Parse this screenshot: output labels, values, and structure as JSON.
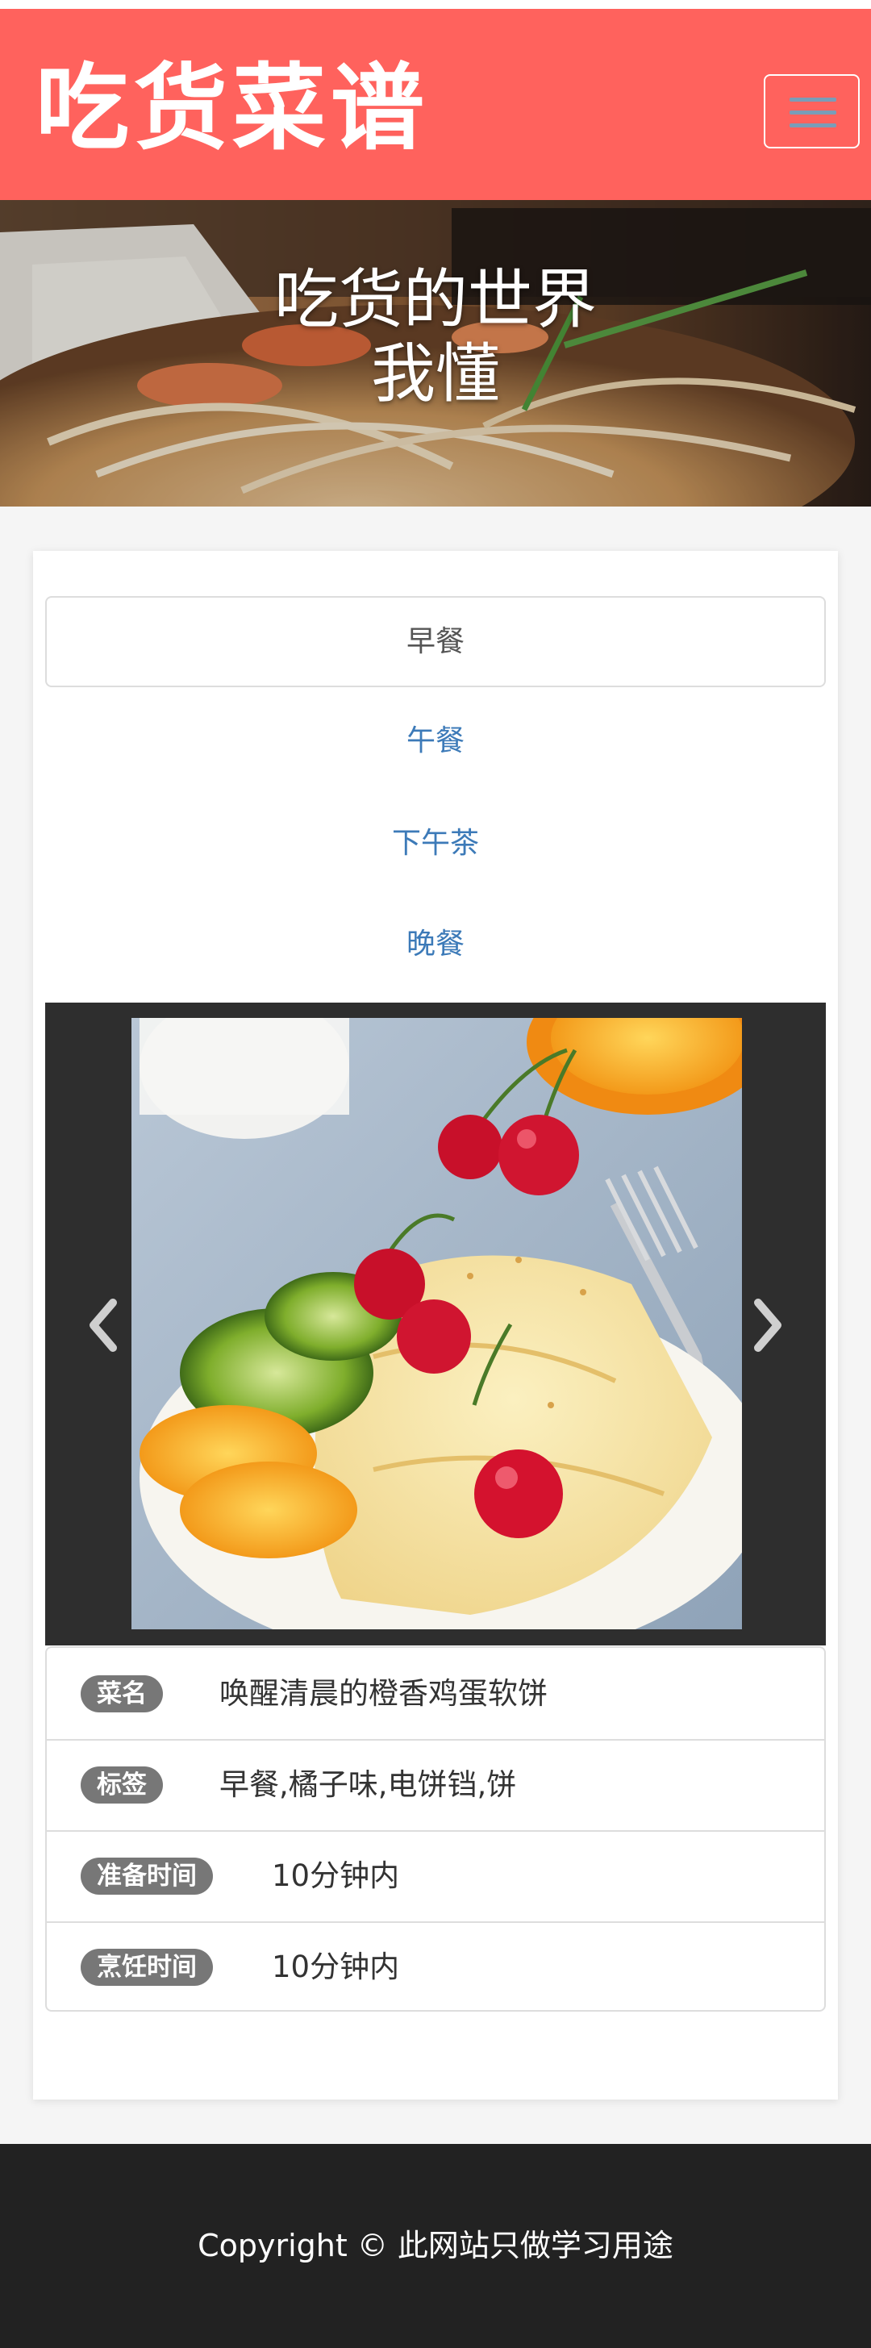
{
  "navbar": {
    "brand": "吃货菜谱",
    "brand_color": "#ff625d",
    "toggle_icon": "hamburger-menu-icon"
  },
  "hero": {
    "line1": "吃货的世界",
    "line2": "我懂"
  },
  "tabs": [
    {
      "label": "早餐",
      "active": true
    },
    {
      "label": "午餐",
      "active": false
    },
    {
      "label": "下午茶",
      "active": false
    },
    {
      "label": "晚餐",
      "active": false
    }
  ],
  "carousel": {
    "prev_icon": "chevron-left-icon",
    "next_icon": "chevron-right-icon"
  },
  "recipe": [
    {
      "label": "菜名",
      "value": "唤醒清晨的橙香鸡蛋软饼"
    },
    {
      "label": "标签",
      "value": "早餐,橘子味,电饼铛,饼"
    },
    {
      "label": "准备时间",
      "value": "10分钟内"
    },
    {
      "label": "烹饪时间",
      "value": "10分钟内"
    }
  ],
  "footer": {
    "copyright": "Copyright © 此网站只做学习用途"
  },
  "colors": {
    "link": "#3c7ab8",
    "badge": "#777777",
    "footer": "#222222"
  }
}
